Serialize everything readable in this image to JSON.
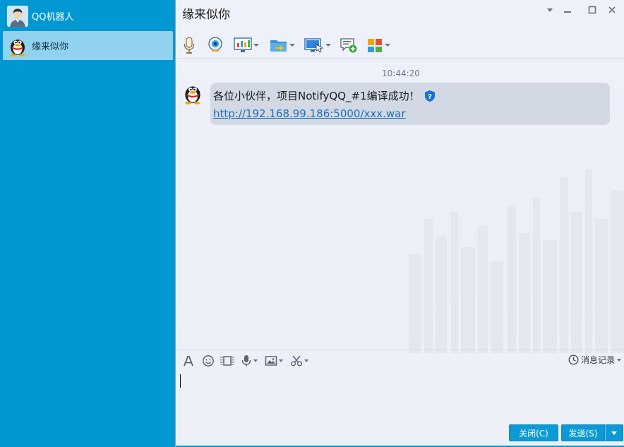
{
  "sidebar": {
    "contacts": [
      {
        "name": "QQ机器人",
        "avatar": "user-avatar"
      },
      {
        "name": "缘来似你",
        "avatar": "qq-penguin-avatar",
        "selected": true
      }
    ]
  },
  "chat": {
    "title": "缘来似你",
    "window_controls": [
      "dropdown-icon",
      "minimize-icon",
      "maximize-icon",
      "close-icon"
    ],
    "toolbar_icons": [
      "voice-call-icon",
      "video-call-icon",
      "screen-share-icon",
      "file-transfer-icon",
      "remote-desktop-icon",
      "discussion-group-icon",
      "app-grid-icon"
    ]
  },
  "messages": [
    {
      "time": "10:44:20",
      "sender_avatar": "qq-penguin-avatar",
      "text": "各位小伙伴，项目NotifyQQ_#1编译成功！",
      "link": "http://192.168.99.186:5000/xxx.war",
      "badge_icon": "security-shield-icon"
    }
  ],
  "input": {
    "toolbar_icons": [
      "font-icon",
      "emoji-icon",
      "screenshot-icon",
      "voice-message-icon",
      "image-icon",
      "scissors-icon"
    ],
    "history_label": "消息记录",
    "value": ""
  },
  "buttons": {
    "close_label": "关闭(C)",
    "send_label": "发送(S)"
  },
  "colors": {
    "sidebar_bg": "#0097d3",
    "selected_item": "#91d3ee",
    "bubble_bg": "#d2d9e4",
    "link": "#1e6dbd",
    "button_bg": "#0c9ad6"
  }
}
